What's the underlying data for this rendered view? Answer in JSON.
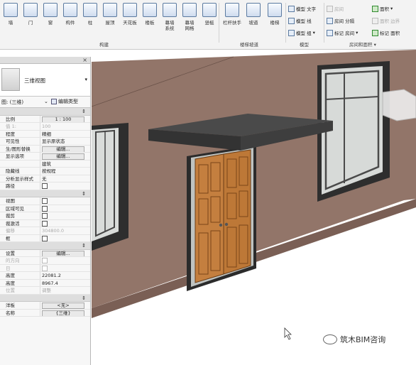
{
  "ribbon": {
    "build_buttons": [
      {
        "label": "墙",
        "icon": "wall-icon"
      },
      {
        "label": "门",
        "icon": "door-icon"
      },
      {
        "label": "窗",
        "icon": "window-icon"
      },
      {
        "label": "构件",
        "icon": "component-icon"
      },
      {
        "label": "柱",
        "icon": "column-icon"
      },
      {
        "label": "屋顶",
        "icon": "roof-icon"
      },
      {
        "label": "天花板",
        "icon": "ceiling-icon"
      },
      {
        "label": "楼板",
        "icon": "floor-icon"
      },
      {
        "label": "幕墙\n系统",
        "icon": "curtain-system-icon"
      },
      {
        "label": "幕墙\n网格",
        "icon": "curtain-grid-icon"
      },
      {
        "label": "竖梃",
        "icon": "mullion-icon"
      }
    ],
    "build_title": "构建",
    "circulation_buttons": [
      {
        "label": "栏杆扶手",
        "icon": "railing-icon"
      },
      {
        "label": "坡道",
        "icon": "ramp-icon"
      },
      {
        "label": "楼梯",
        "icon": "stair-icon"
      }
    ],
    "circulation_title": "楼梯坡道",
    "model_items": [
      "模型 文字",
      "模型 线",
      "模型 组"
    ],
    "model_title": "模型",
    "room_items": [
      "房间",
      "房间 分隔",
      "标记 房间",
      "面积",
      "面积 边界",
      "标记 面积"
    ],
    "room_title": "房间和面积"
  },
  "props": {
    "close": "×",
    "type_name": "三维视图",
    "filter": "图: (三维)",
    "edit_type": "编辑类型",
    "rows": [
      {
        "kind": "sec"
      },
      {
        "k": "比例",
        "v": "1 : 100",
        "box": true
      },
      {
        "k": "值 1:",
        "v": "100",
        "dimk": true,
        "dim": true
      },
      {
        "k": "程度",
        "v": "精细"
      },
      {
        "k": "可见性",
        "v": "显示原状态"
      },
      {
        "k": "生/图形替换",
        "v": "编辑...",
        "box": true
      },
      {
        "k": "显示选项",
        "v": "编辑...",
        "box": true
      },
      {
        "k": "",
        "v": "建筑"
      },
      {
        "k": "隐藏线",
        "v": "按规程"
      },
      {
        "k": "分析显示样式",
        "v": "无"
      },
      {
        "k": "路径",
        "chk": true
      },
      {
        "kind": "sec"
      },
      {
        "k": "视图",
        "chk": true
      },
      {
        "k": "区域可见",
        "chk": true
      },
      {
        "k": "裁剪",
        "chk": true
      },
      {
        "k": "裁激活",
        "chk": true
      },
      {
        "k": "偏移",
        "v": "304800.0",
        "dimk": true,
        "dim": true
      },
      {
        "k": "框",
        "chk": true
      },
      {
        "kind": "sec"
      },
      {
        "k": "设置",
        "v": "编辑...",
        "box": true
      },
      {
        "k": "的方向",
        "dimk": true,
        "chk": true,
        "chkdim": true
      },
      {
        "k": "日",
        "dimk": true,
        "chk": true,
        "chkdim": true
      },
      {
        "k": "高度",
        "v": "22081.2"
      },
      {
        "k": "高度",
        "v": "8967.4"
      },
      {
        "k": "位置",
        "v": "调整",
        "dimk": true,
        "dim": true
      },
      {
        "kind": "sec"
      },
      {
        "k": "洋板",
        "v": "<无>",
        "box": true
      },
      {
        "k": "名称",
        "v": "{三维}",
        "box": true
      }
    ]
  },
  "watermark": "筑木BIM咨询",
  "colors": {
    "wall": "#927569",
    "door": "#c47f3f",
    "canopy": "#3e3e3e"
  }
}
